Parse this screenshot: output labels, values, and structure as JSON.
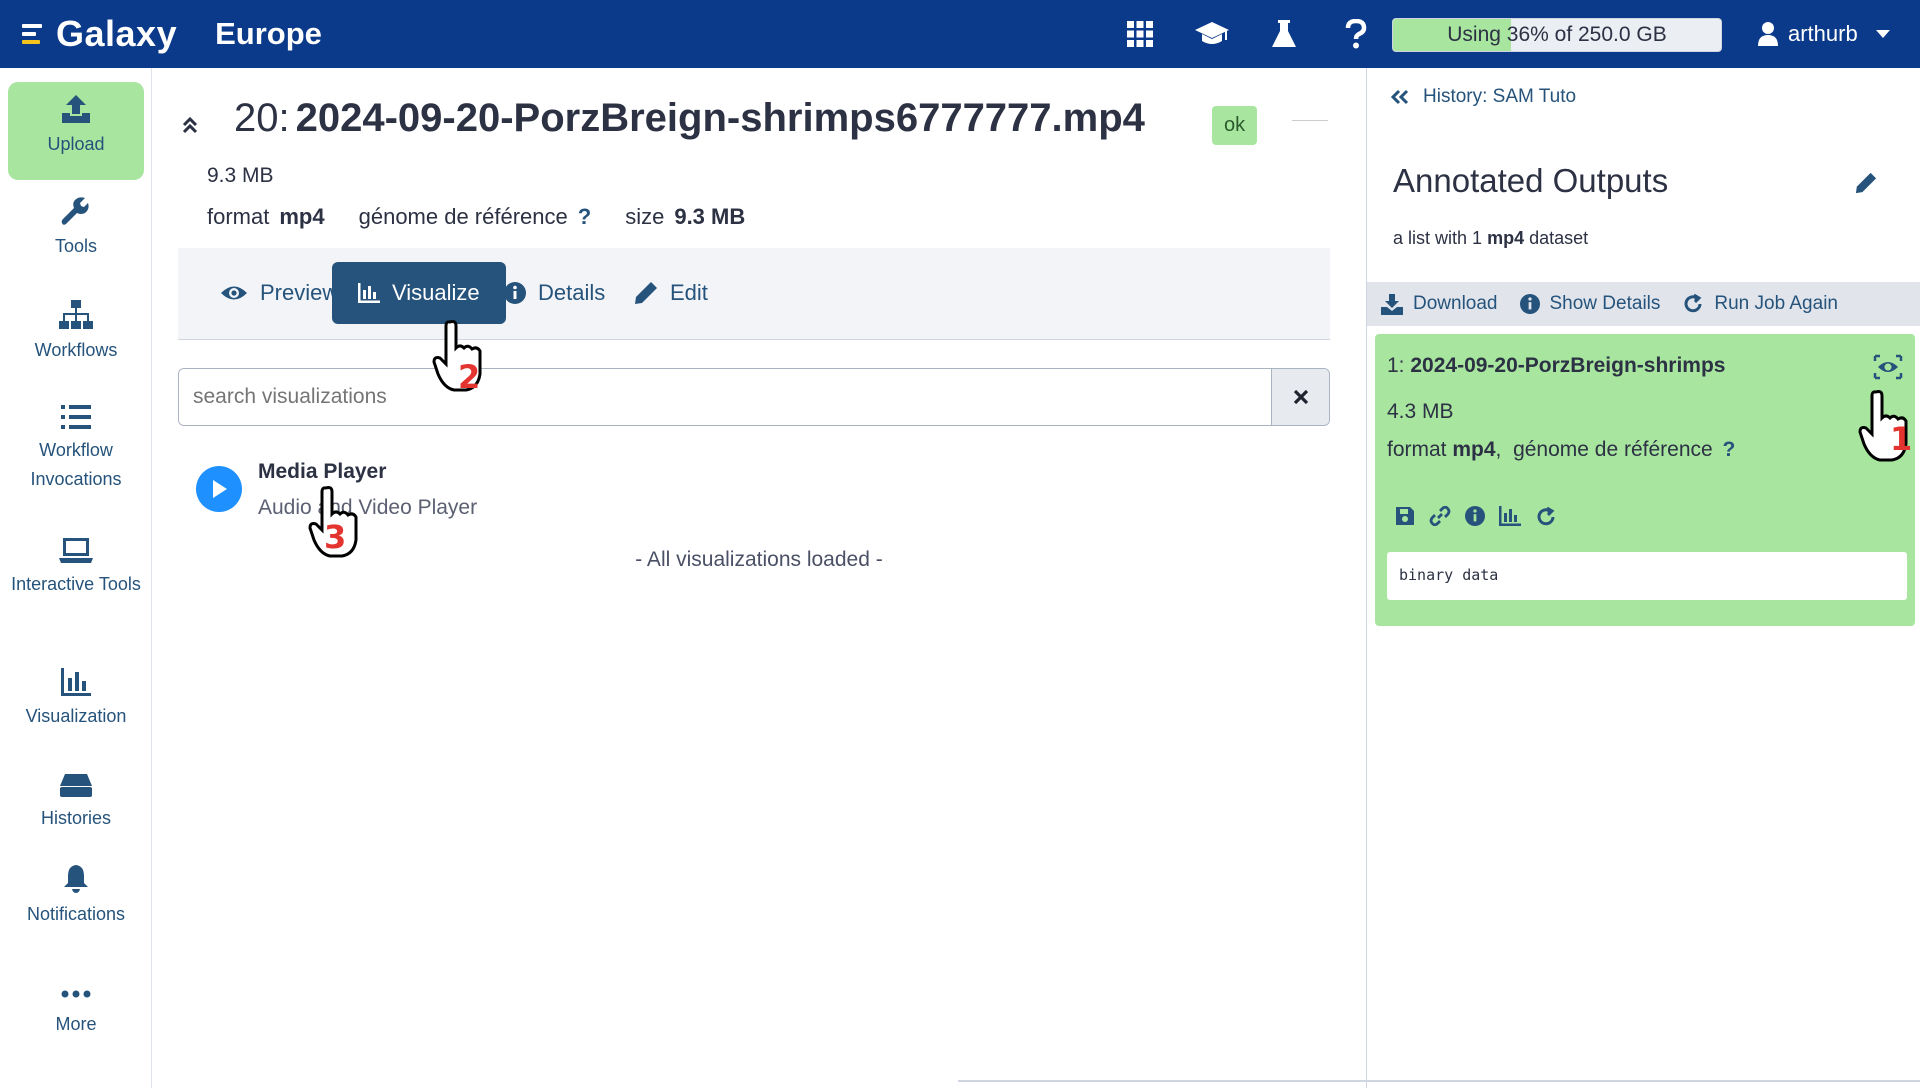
{
  "topbar": {
    "brand": "Galaxy",
    "subtitle": "Europe",
    "icons": [
      "apps-grid-icon",
      "training-cap-icon",
      "lab-flask-icon",
      "help-icon"
    ],
    "quota": {
      "text": "Using 36% of 250.0 GB",
      "percent": 36
    },
    "user": "arthurb"
  },
  "activitybar": {
    "items": [
      {
        "label": "Upload",
        "icon": "upload-icon",
        "active": true
      },
      {
        "label": "Tools",
        "icon": "wrench-icon"
      },
      {
        "label": "Workflows",
        "icon": "sitemap-icon"
      },
      {
        "label": "Workflow Invocations",
        "icon": "list-icon"
      },
      {
        "label": "Interactive Tools",
        "icon": "laptop-icon"
      },
      {
        "label": "Visualization",
        "icon": "chart-icon"
      },
      {
        "label": "Histories",
        "icon": "hdd-icon"
      },
      {
        "label": "Notifications",
        "icon": "bell-icon"
      },
      {
        "label": "More",
        "icon": "ellipsis-icon"
      }
    ]
  },
  "dataset": {
    "hid": "20:",
    "name": "2024-09-20-PorzBreign-shrimps6777777.mp4",
    "state": "ok",
    "size": "9.3 MB",
    "meta": {
      "format_label": "format",
      "format_value": "mp4",
      "genome_label": "génome de référence",
      "genome_value": "?",
      "size_label": "size",
      "size_value": "9.3 MB"
    }
  },
  "tabs": {
    "preview": "Preview",
    "visualize": "Visualize",
    "details": "Details",
    "edit": "Edit",
    "active": "visualize"
  },
  "search": {
    "placeholder": "search visualizations"
  },
  "visualizations": {
    "items": [
      {
        "name": "Media Player",
        "description": "Audio and Video Player"
      }
    ],
    "footer": "- All visualizations loaded -"
  },
  "history": {
    "back_label": "History: SAM Tuto",
    "collection": {
      "title": "Annotated Outputs",
      "desc_prefix": "a list with 1",
      "desc_format": "mp4",
      "desc_suffix": "dataset"
    },
    "actions": {
      "download": "Download",
      "show_details": "Show Details",
      "run_again": "Run Job Again"
    },
    "element": {
      "hid": "1:",
      "name": "2024-09-20-PorzBreign-shrimps",
      "size": "4.3 MB",
      "format_label": "format",
      "format_value": "mp4",
      "genome_label": "génome de référence",
      "genome_value": "?",
      "peek": "binary data"
    }
  },
  "cursors": [
    "1",
    "2",
    "3"
  ],
  "colors": {
    "masthead": "#0c3a8a",
    "accent": "#25537b",
    "ok_green": "#a8e6a0",
    "play_blue": "#1e90ff",
    "marker_red": "#e3342f"
  }
}
